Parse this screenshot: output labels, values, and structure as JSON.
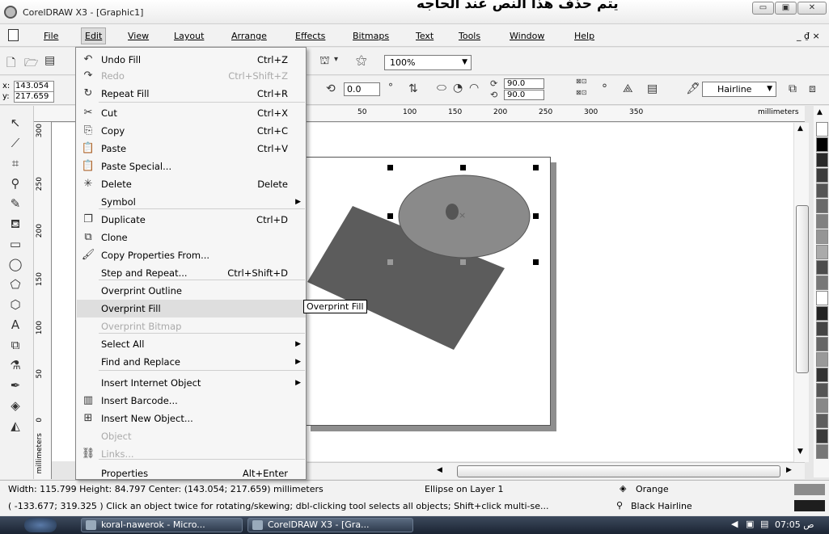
{
  "window": {
    "title": "CorelDRAW X3 - [Graphic1]",
    "top_text": "يتم حذف هذا النص عند الحاجه",
    "minimize_glyph": "▭",
    "maximize_glyph": "▣",
    "close_glyph": "✕"
  },
  "menubar": {
    "items": [
      "File",
      "Edit",
      "View",
      "Layout",
      "Arrange",
      "Effects",
      "Bitmaps",
      "Text",
      "Tools",
      "Window",
      "Help"
    ],
    "right_glyphs": "_ ₫ ×"
  },
  "toolbar": {
    "zoom": "100%"
  },
  "propbar": {
    "x_label": "x:",
    "x_value": "143.054",
    "y_label": "y:",
    "y_value": "217.659",
    "rotation": "0.0",
    "degree": "°",
    "arc_start": "90.0",
    "arc_end": "90.0",
    "outline": "Hairline"
  },
  "ruler": {
    "h_ticks": [
      "50",
      "100",
      "150",
      "200",
      "250",
      "300",
      "350"
    ],
    "units": "millimeters",
    "v_ticks": [
      "300",
      "250",
      "200",
      "150",
      "100",
      "50",
      "0"
    ],
    "v_units": "millimeters"
  },
  "edit_menu": {
    "items": [
      {
        "icon": "undo-icon",
        "glyph": "↶",
        "label": "Undo Fill",
        "shortcut": "Ctrl+Z",
        "disabled": false
      },
      {
        "icon": "redo-icon",
        "glyph": "↷",
        "label": "Redo",
        "shortcut": "Ctrl+Shift+Z",
        "disabled": true
      },
      {
        "icon": "repeat-icon",
        "glyph": "↻",
        "label": "Repeat Fill",
        "shortcut": "Ctrl+R",
        "disabled": false
      },
      {
        "icon": "cut-icon",
        "glyph": "✂",
        "label": "Cut",
        "shortcut": "Ctrl+X",
        "disabled": false
      },
      {
        "icon": "copy-icon",
        "glyph": "⎘",
        "label": "Copy",
        "shortcut": "Ctrl+C",
        "disabled": false
      },
      {
        "icon": "paste-icon",
        "glyph": "📋",
        "label": "Paste",
        "shortcut": "Ctrl+V",
        "disabled": false
      },
      {
        "icon": "paste-special-icon",
        "glyph": "📋",
        "label": "Paste Special...",
        "shortcut": "",
        "disabled": false
      },
      {
        "icon": "delete-icon",
        "glyph": "✳",
        "label": "Delete",
        "shortcut": "Delete",
        "disabled": false
      },
      {
        "icon": "",
        "glyph": "",
        "label": "Symbol",
        "shortcut": "",
        "disabled": false,
        "submenu": true
      },
      {
        "icon": "duplicate-icon",
        "glyph": "❐",
        "label": "Duplicate",
        "shortcut": "Ctrl+D",
        "disabled": false
      },
      {
        "icon": "clone-icon",
        "glyph": "⧉",
        "label": "Clone",
        "shortcut": "",
        "disabled": false
      },
      {
        "icon": "copy-properties-icon",
        "glyph": "🖌",
        "label": "Copy Properties From...",
        "shortcut": "",
        "disabled": false
      },
      {
        "icon": "",
        "glyph": "",
        "label": "Step and Repeat...",
        "shortcut": "Ctrl+Shift+D",
        "disabled": false
      },
      {
        "icon": "",
        "glyph": "",
        "label": "Overprint Outline",
        "shortcut": "",
        "disabled": false
      },
      {
        "icon": "",
        "glyph": "",
        "label": "Overprint Fill",
        "shortcut": "",
        "disabled": false,
        "highlight": true
      },
      {
        "icon": "",
        "glyph": "",
        "label": "Overprint Bitmap",
        "shortcut": "",
        "disabled": true
      },
      {
        "icon": "",
        "glyph": "",
        "label": "Select All",
        "shortcut": "",
        "disabled": false,
        "submenu": true
      },
      {
        "icon": "",
        "glyph": "",
        "label": "Find and Replace",
        "shortcut": "",
        "disabled": false,
        "submenu": true
      },
      {
        "icon": "",
        "glyph": "",
        "label": "Insert Internet Object",
        "shortcut": "",
        "disabled": false,
        "submenu": true
      },
      {
        "icon": "barcode-icon",
        "glyph": "▥",
        "label": "Insert Barcode...",
        "shortcut": "",
        "disabled": false
      },
      {
        "icon": "insert-object-icon",
        "glyph": "⊞",
        "label": "Insert New Object...",
        "shortcut": "",
        "disabled": false
      },
      {
        "icon": "",
        "glyph": "",
        "label": "Object",
        "shortcut": "",
        "disabled": true
      },
      {
        "icon": "links-icon",
        "glyph": "⛓",
        "label": "Links...",
        "shortcut": "",
        "disabled": true
      },
      {
        "icon": "",
        "glyph": "",
        "label": "Properties",
        "shortcut": "Alt+Enter",
        "disabled": false
      }
    ]
  },
  "tooltip": "Overprint Fill",
  "status": {
    "line1": "Width: 115.799 Height: 84.797 Center: (143.054; 217.659) millimeters",
    "object_info": "Ellipse on Layer 1",
    "fill_name": "Orange",
    "line2": "( -133.677; 319.325 )  Click an object twice for rotating/skewing; dbl-clicking tool selects all objects; Shift+click multi-se...",
    "outline_name": "Black  Hairline",
    "fill_color": "#8c8c8c",
    "outline_color": "#1e1e1e"
  },
  "taskbar": {
    "btn1": "koral-nawerok - Micro...",
    "btn2": "CorelDRAW X3 - [Gra...",
    "clock": "07:05 ص"
  },
  "colors": {
    "rect_fill": "#5c5c5c",
    "ellipse_fill": "#8a8a8a",
    "center_dot": "#555555",
    "palette": [
      "#ffffff",
      "#000000",
      "#2a2a2a",
      "#3c3c3c",
      "#555555",
      "#6a6a6a",
      "#808080",
      "#959595",
      "#aaaaaa",
      "#4c4c4c",
      "#777777",
      "#ffffff",
      "#222222",
      "#444444",
      "#666666",
      "#999999",
      "#333333",
      "#555555",
      "#888888",
      "#5e5e5e",
      "#3a3a3a",
      "#777777"
    ]
  }
}
